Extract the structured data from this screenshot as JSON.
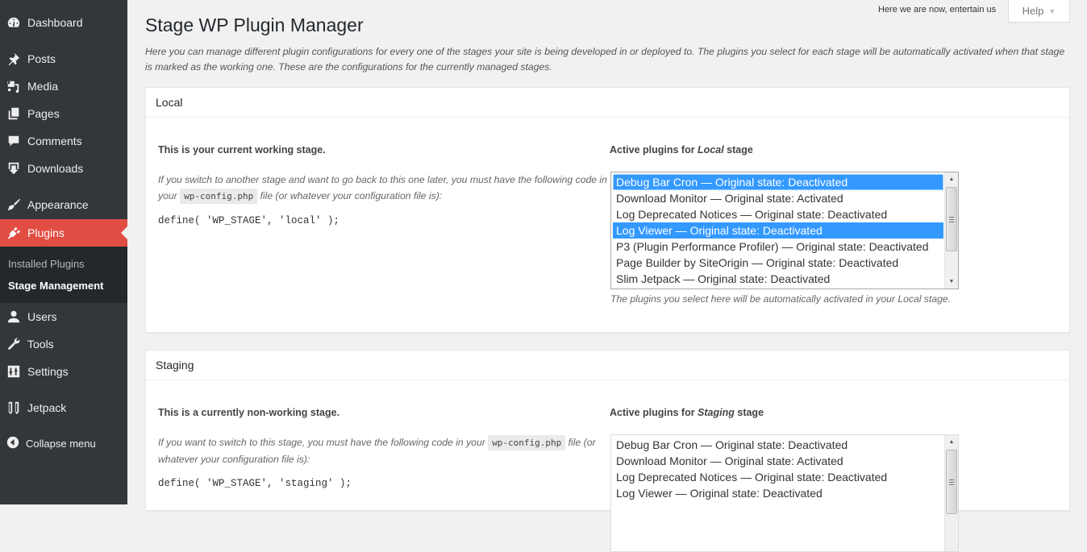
{
  "sidebar": {
    "items": [
      {
        "label": "Dashboard",
        "icon": "dashboard-icon"
      },
      {
        "label": "Posts",
        "icon": "pin-icon"
      },
      {
        "label": "Media",
        "icon": "media-icon"
      },
      {
        "label": "Pages",
        "icon": "pages-icon"
      },
      {
        "label": "Comments",
        "icon": "comment-icon"
      },
      {
        "label": "Downloads",
        "icon": "download-icon"
      },
      {
        "label": "Appearance",
        "icon": "paintbrush-icon"
      },
      {
        "label": "Plugins",
        "icon": "plugin-icon",
        "current": true
      },
      {
        "label": "Users",
        "icon": "user-icon"
      },
      {
        "label": "Tools",
        "icon": "wrench-icon"
      },
      {
        "label": "Settings",
        "icon": "settings-icon"
      },
      {
        "label": "Jetpack",
        "icon": "jetpack-icon"
      }
    ],
    "submenu": [
      {
        "label": "Installed Plugins"
      },
      {
        "label": "Stage Management",
        "current": true
      }
    ],
    "collapse_label": "Collapse menu"
  },
  "topbar": {
    "tagline": "Here we are now, entertain us",
    "help_label": "Help",
    "help_caret": "▼"
  },
  "header": {
    "title": "Stage WP Plugin Manager",
    "description": "Here you can manage different plugin configurations for every one of the stages your site is being developed in or deployed to. The plugins you select for each stage will be automatically activated when that stage is marked as the working one. These are the configurations for the currently managed stages."
  },
  "stages": [
    {
      "name": "Local",
      "status": "This is your current working stage.",
      "note_before": "If you switch to another stage and want to go back to this one later, you must have the following code in your ",
      "config_file": "wp-config.php",
      "note_after": " file (or whatever your configuration file is):",
      "code": "define( 'WP_STAGE', 'local' );",
      "plugins_label_prefix": "Active plugins for ",
      "plugins_label_stage": "Local",
      "plugins_label_suffix": " stage",
      "plugins": [
        {
          "label": "Debug Bar Cron — Original state: Deactivated",
          "selected": true,
          "focused": true
        },
        {
          "label": "Download Monitor — Original state: Activated",
          "selected": false
        },
        {
          "label": "Log Deprecated Notices — Original state: Deactivated",
          "selected": false
        },
        {
          "label": "Log Viewer — Original state: Deactivated",
          "selected": true
        },
        {
          "label": "P3 (Plugin Performance Profiler) — Original state: Deactivated",
          "selected": false
        },
        {
          "label": "Page Builder by SiteOrigin — Original state: Deactivated",
          "selected": false
        },
        {
          "label": "Slim Jetpack — Original state: Deactivated",
          "selected": false
        }
      ],
      "select_help": "The plugins you select here will be automatically activated in your Local stage."
    },
    {
      "name": "Staging",
      "status": "This is a currently non-working stage.",
      "note_before": "If you want to switch to this stage, you must have the following code in your ",
      "config_file": "wp-config.php",
      "note_after": " file (or whatever your configuration file is):",
      "code": "define( 'WP_STAGE', 'staging' );",
      "plugins_label_prefix": "Active plugins for ",
      "plugins_label_stage": "Staging",
      "plugins_label_suffix": " stage",
      "plugins": [
        {
          "label": "Debug Bar Cron — Original state: Deactivated",
          "selected": false
        },
        {
          "label": "Download Monitor — Original state: Activated",
          "selected": false
        },
        {
          "label": "Log Deprecated Notices — Original state: Deactivated",
          "selected": false
        },
        {
          "label": "Log Viewer — Original state: Deactivated",
          "selected": false
        }
      ]
    }
  ],
  "colors": {
    "sidebar_bg": "#32373c",
    "submenu_bg": "#23282d",
    "current_menu": "#e14d43",
    "selection": "#3399ff",
    "page_bg": "#f1f1f1"
  }
}
